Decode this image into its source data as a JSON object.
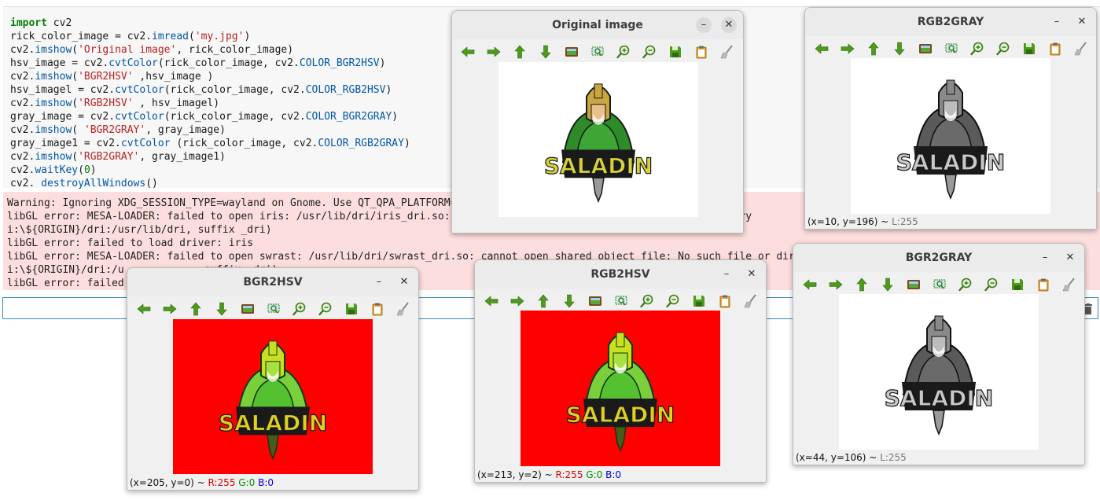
{
  "code_lines": [
    [
      {
        "t": "import",
        "c": "kw"
      },
      {
        "t": " cv2",
        "c": ""
      }
    ],
    [
      {
        "t": "rick_color_image = cv2.",
        "c": ""
      },
      {
        "t": "imread",
        "c": "fn"
      },
      {
        "t": "(",
        "c": ""
      },
      {
        "t": "'my.jpg'",
        "c": "str"
      },
      {
        "t": ")",
        "c": ""
      }
    ],
    [
      {
        "t": "cv2.",
        "c": ""
      },
      {
        "t": "imshow",
        "c": "fn"
      },
      {
        "t": "(",
        "c": ""
      },
      {
        "t": "'Original image'",
        "c": "str"
      },
      {
        "t": ", rick_color_image)",
        "c": ""
      }
    ],
    [
      {
        "t": "hsv_image = cv2.",
        "c": ""
      },
      {
        "t": "cvtColor",
        "c": "fn"
      },
      {
        "t": "(rick_color_image, cv2.",
        "c": ""
      },
      {
        "t": "COLOR_BGR2HSV",
        "c": "const"
      },
      {
        "t": ")",
        "c": ""
      }
    ],
    [
      {
        "t": "cv2.",
        "c": ""
      },
      {
        "t": "imshow",
        "c": "fn"
      },
      {
        "t": "(",
        "c": ""
      },
      {
        "t": "'BGR2HSV'",
        "c": "str"
      },
      {
        "t": " ,hsv_image )",
        "c": ""
      }
    ],
    [
      {
        "t": "hsv_imagel = cv2.",
        "c": ""
      },
      {
        "t": "cvtColor",
        "c": "fn"
      },
      {
        "t": "(rick_color_image, cv2.",
        "c": ""
      },
      {
        "t": "COLOR_RGB2HSV",
        "c": "const"
      },
      {
        "t": ")",
        "c": ""
      }
    ],
    [
      {
        "t": "cv2.",
        "c": ""
      },
      {
        "t": "imshow",
        "c": "fn"
      },
      {
        "t": "(",
        "c": ""
      },
      {
        "t": "'RGB2HSV'",
        "c": "str"
      },
      {
        "t": " , hsv_imagel)",
        "c": ""
      }
    ],
    [
      {
        "t": "gray_image = cv2.",
        "c": ""
      },
      {
        "t": "cvtColor",
        "c": "fn"
      },
      {
        "t": "(rick_color_image, cv2.",
        "c": ""
      },
      {
        "t": "COLOR_BGR2GRAY",
        "c": "const"
      },
      {
        "t": ")",
        "c": ""
      }
    ],
    [
      {
        "t": "cv2.",
        "c": ""
      },
      {
        "t": "imshow",
        "c": "fn"
      },
      {
        "t": "( ",
        "c": ""
      },
      {
        "t": "'BGR2GRAY'",
        "c": "str"
      },
      {
        "t": ", gray_image)",
        "c": ""
      }
    ],
    [
      {
        "t": "gray_image1 = cv2.",
        "c": ""
      },
      {
        "t": "cvtColor",
        "c": "fn"
      },
      {
        "t": " (rick_color_image, cv2.",
        "c": ""
      },
      {
        "t": "COLOR_RGB2GRAY",
        "c": "const"
      },
      {
        "t": ")",
        "c": ""
      }
    ],
    [
      {
        "t": "cv2.",
        "c": ""
      },
      {
        "t": "imshow",
        "c": "fn"
      },
      {
        "t": "(",
        "c": ""
      },
      {
        "t": "'RGB2GRAY'",
        "c": "str"
      },
      {
        "t": ", gray_image1)",
        "c": ""
      }
    ],
    [
      {
        "t": "cv2.",
        "c": ""
      },
      {
        "t": "waitKey",
        "c": "fn"
      },
      {
        "t": "(",
        "c": ""
      },
      {
        "t": "0",
        "c": "num"
      },
      {
        "t": ")",
        "c": ""
      }
    ],
    [
      {
        "t": "cv2. ",
        "c": ""
      },
      {
        "t": "destroyAllWindows",
        "c": "fn"
      },
      {
        "t": "()",
        "c": ""
      }
    ]
  ],
  "stderr_lines": [
    "Warning: Ignoring XDG_SESSION_TYPE=wayland on Gnome. Use QT_QPA_PLATFORM=",
    "libGL error: MESA-LOADER: failed to open iris: /usr/lib/dri/iris_dri.so:                                      r directory",
    "i:\\${ORIGIN}/dri:/usr/lib/dri, suffix _dri)",
    "libGL error: failed to load driver: iris",
    "libGL error: MESA-LOADER: failed to open swrast: /usr/lib/dri/swrast_dri.so: cannot open shared object file: No such file or dir                                    dr",
    "i:\\${ORIGIN}/dri:/u             suffix _dri)",
    "libGL error: failed"
  ],
  "logo_text": "SALADIN",
  "windows": {
    "original": {
      "title": "Original image",
      "min_glyph": "–",
      "close_glyph": "✕"
    },
    "rgb2gray": {
      "title": "RGB2GRAY",
      "min_glyph": "–",
      "close_glyph": "✕",
      "status": {
        "coord": "(x=10, y=196) ~ ",
        "l": "L:255"
      }
    },
    "bgr2gray": {
      "title": "BGR2GRAY",
      "min_glyph": "–",
      "close_glyph": "✕",
      "status": {
        "coord": "(x=44, y=106) ~ ",
        "l": "L:255"
      }
    },
    "bgr2hsv": {
      "title": "BGR2HSV",
      "min_glyph": "–",
      "close_glyph": "✕",
      "status": {
        "coord": "(x=205, y=0) ~ ",
        "r": "R:255",
        "g": "G:0",
        "b": "B:0"
      }
    },
    "rgb2hsv": {
      "title": "RGB2HSV",
      "min_glyph": "–",
      "close_glyph": "✕",
      "status": {
        "coord": "(x=213, y=2) ~ ",
        "r": "R:255",
        "g": "G:0",
        "b": "B:0"
      }
    }
  },
  "toolbar_icons": [
    "arrow-left-icon",
    "arrow-right-icon",
    "arrow-up-icon",
    "arrow-down-icon",
    "image-icon",
    "zoom-rect-icon",
    "zoom-in-icon",
    "zoom-out-icon",
    "save-icon",
    "clipboard-icon",
    "brush-icon"
  ],
  "colors": {
    "stderr_bg": "#fddede",
    "hsv_bg": "#ff0000",
    "icon_green": "#4d9a1d"
  }
}
